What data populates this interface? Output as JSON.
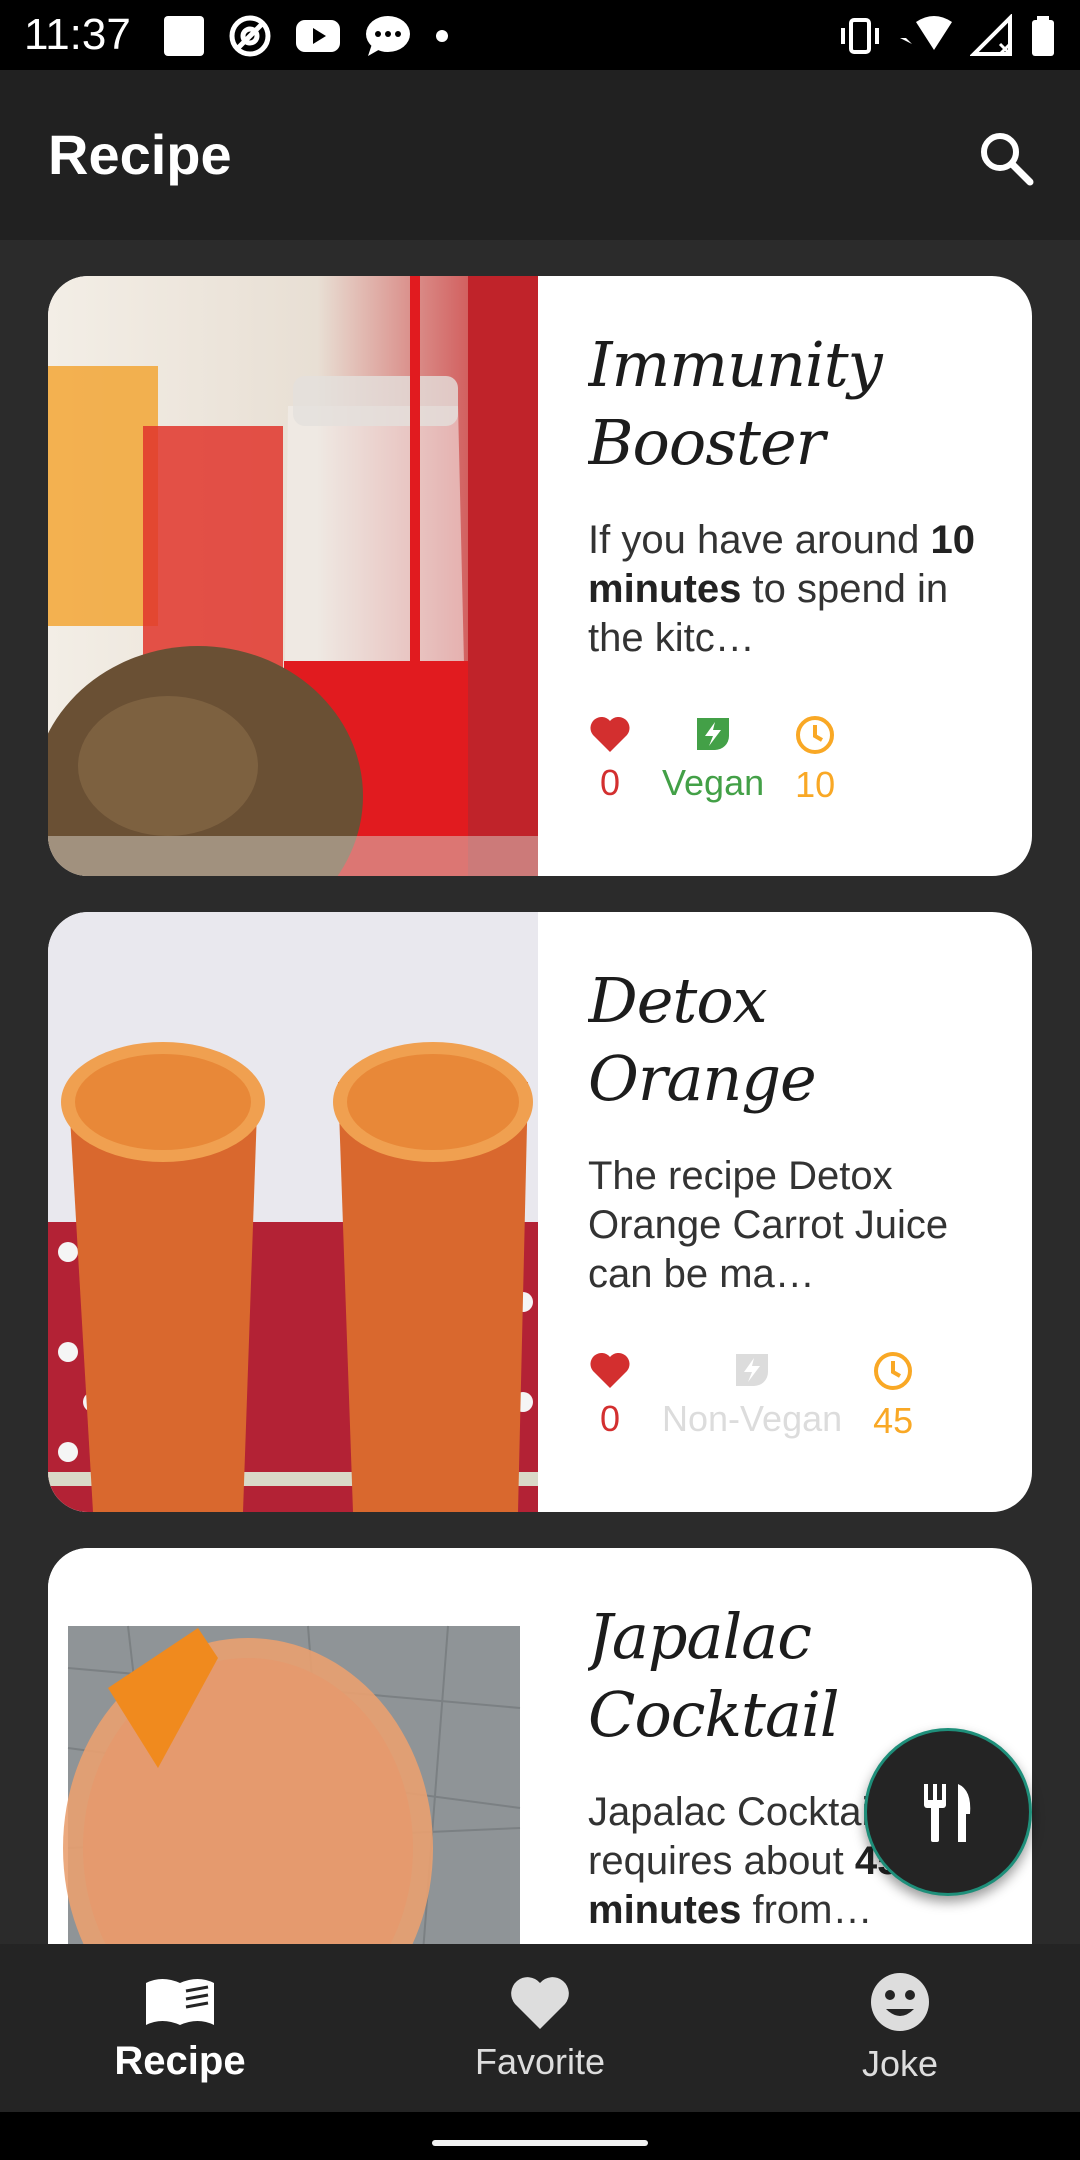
{
  "status_bar": {
    "time": "11:37"
  },
  "app_bar": {
    "title": "Recipe"
  },
  "recipes": [
    {
      "title": "Immunity Booster Beet…",
      "desc_pre": "If you have around ",
      "desc_bold": "10 minutes",
      "desc_post": " to spend in the kitc…",
      "likes": "0",
      "diet": "Vegan",
      "minutes": "10"
    },
    {
      "title": "Detox Orange Carrot Juice",
      "desc_pre": "The recipe Detox Orange Carrot Juice can be ma…",
      "desc_bold": "",
      "desc_post": "",
      "likes": "0",
      "diet": "Non-Vegan",
      "minutes": "45"
    },
    {
      "title": "Japalac Cocktail",
      "desc_pre": "Japalac Cocktail requires about ",
      "desc_bold": "45 minutes",
      "desc_post": " from…"
    }
  ],
  "bottom_nav": {
    "items": [
      {
        "label": "Recipe"
      },
      {
        "label": "Favorite"
      },
      {
        "label": "Joke"
      }
    ]
  },
  "colors": {
    "like": "#d32f2f",
    "vegan": "#43a047",
    "time": "#f9a825",
    "fab_border": "#1e8f7a"
  }
}
